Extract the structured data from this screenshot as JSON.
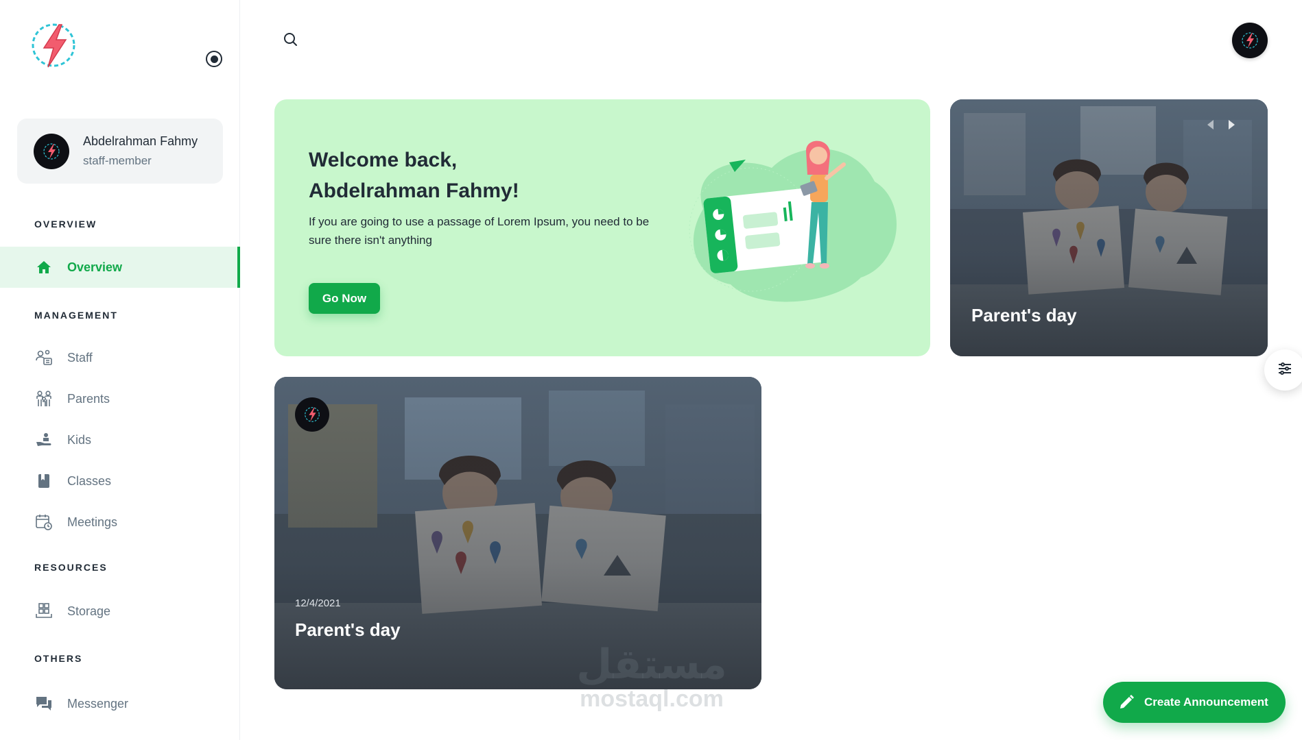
{
  "sidebar": {
    "user": {
      "name": "Abdelrahman Fahmy",
      "role": "staff-member"
    },
    "sections": {
      "overview": "OVERVIEW",
      "management": "MANAGEMENT",
      "resources": "RESOURCES",
      "others": "OTHERS"
    },
    "items": {
      "overview": {
        "label": "Overview",
        "icon": "home-icon",
        "active": true
      },
      "staff": {
        "label": "Staff",
        "icon": "staff-icon"
      },
      "parents": {
        "label": "Parents",
        "icon": "parents-icon"
      },
      "kids": {
        "label": "Kids",
        "icon": "kids-icon"
      },
      "classes": {
        "label": "Classes",
        "icon": "book-icon"
      },
      "meetings": {
        "label": "Meetings",
        "icon": "calendar-clock-icon"
      },
      "storage": {
        "label": "Storage",
        "icon": "storage-icon"
      },
      "messenger": {
        "label": "Messenger",
        "icon": "chat-icon"
      }
    }
  },
  "welcome": {
    "title_line1": "Welcome back,",
    "title_line2": "Abdelrahman Fahmy!",
    "text": "If you are going to use a passage of Lorem Ipsum, you need to be sure there isn't anything",
    "button": "Go Now"
  },
  "featured_card": {
    "title": "Parent's day"
  },
  "announcement_card": {
    "date": "12/4/2021",
    "title": "Parent's day"
  },
  "actions": {
    "create_announcement": "Create Announcement"
  },
  "watermark": {
    "arabic": "مستقل",
    "latin": "mostaql.com"
  },
  "colors": {
    "primary": "#11a94a",
    "welcome_bg": "#c8f7cc",
    "active_bg": "#e6f7ec",
    "text": "#212b36",
    "muted": "#637381"
  }
}
